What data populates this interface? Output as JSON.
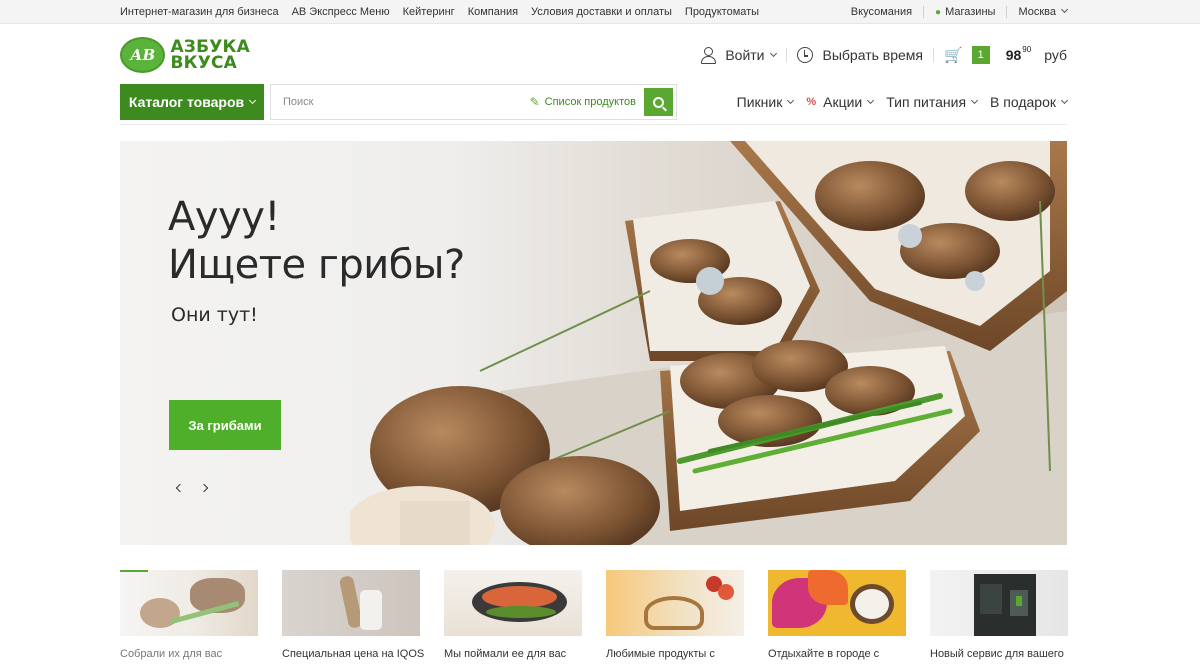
{
  "topbar": {
    "links": [
      "Интернет-магазин для бизнеса",
      "АВ Экспресс Меню",
      "Кейтеринг",
      "Компания",
      "Условия доставки и оплаты",
      "Продуктоматы"
    ],
    "vkusomaniya": "Вкусомания",
    "stores": "Магазины",
    "city": "Москва"
  },
  "logo": {
    "mark": "АВ",
    "line1": "АЗБУКА",
    "line2": "ВКУСА"
  },
  "header": {
    "login": "Войти",
    "choose_time": "Выбрать время",
    "cart_count": "1",
    "price_main": "98",
    "price_cents": "90",
    "currency": "руб"
  },
  "catalog_button": "Каталог товаров",
  "search": {
    "placeholder": "Поиск",
    "list_label": "Список продуктов"
  },
  "subnav": {
    "picnic": "Пикник",
    "promo_icon": "%",
    "promo": "Акции",
    "diet": "Тип питания",
    "gift": "В подарок"
  },
  "hero": {
    "title_line1": "Аууу!",
    "title_line2": "Ищете грибы?",
    "subtitle": "Они тут!",
    "button": "За грибами"
  },
  "cards": [
    {
      "caption": "Собрали их для вас",
      "image": "mushroom-toasts"
    },
    {
      "caption": "Специальная цена на IQOS",
      "image": "iqos-device"
    },
    {
      "caption": "Мы поймали ее для вас",
      "image": "grilled-fish"
    },
    {
      "caption": "Любимые продукты с",
      "image": "bread-basket-apples"
    },
    {
      "caption": "Отдыхайте в городе с",
      "image": "tropical-leaves-coconut"
    },
    {
      "caption": "Новый сервис для вашего",
      "image": "vending-machine"
    }
  ],
  "colors": {
    "brand_green": "#3d8a1f",
    "accent_green": "#5aa832",
    "sale_red": "#d9534f"
  }
}
